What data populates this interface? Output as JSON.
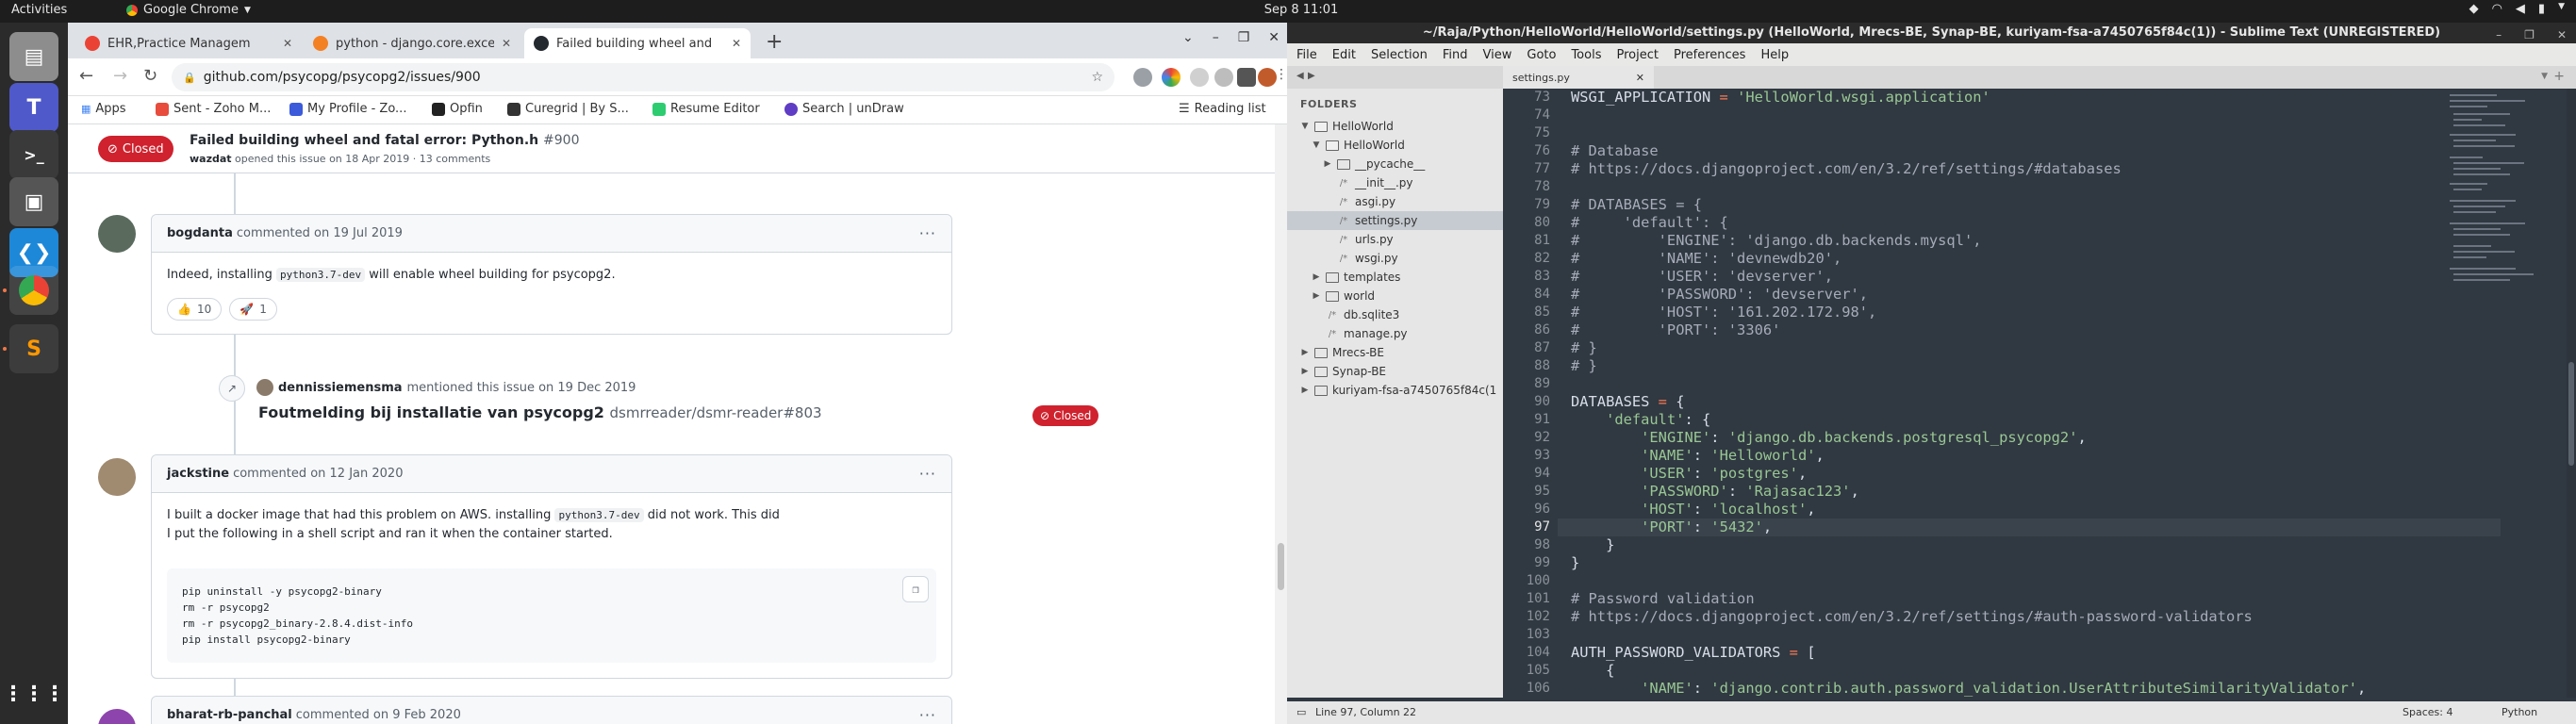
{
  "topbar": {
    "activities": "Activities",
    "app_name": "Google Chrome",
    "clock": "Sep 8  11:01"
  },
  "dock": {
    "apps": [
      "files",
      "teams",
      "terminal",
      "image-viewer",
      "vscode",
      "chrome",
      "sublime-text",
      "app-grid"
    ]
  },
  "chrome": {
    "tabs": [
      {
        "label": "EHR,Practice Managem",
        "favicon_color": "#ea4335"
      },
      {
        "label": "python - django.core.exce",
        "favicon_color": "#f48024"
      },
      {
        "label": "Failed building wheel and",
        "favicon_color": "#24292f"
      }
    ],
    "url": "github.com/psycopg/psycopg2/issues/900",
    "bookmarks": [
      {
        "label": "Apps",
        "color": "#4285f4"
      },
      {
        "label": "Sent - Zoho M...",
        "color": "#e74c3c"
      },
      {
        "label": "My Profile - Zo...",
        "color": "#3b5bdb"
      },
      {
        "label": "Opfin",
        "color": "#222222"
      },
      {
        "label": "Curegrid | By S...",
        "color": "#333333"
      },
      {
        "label": "Resume Editor",
        "color": "#2ecc71"
      },
      {
        "label": "Search | unDraw",
        "color": "#5f3dc4"
      }
    ],
    "reading_list": "Reading list"
  },
  "issue": {
    "state": "Closed",
    "title": "Failed building wheel and fatal error: Python.h",
    "number": "#900",
    "author": "wazdat",
    "meta": "opened this issue on 18 Apr 2019 · 13 comments",
    "comments": [
      {
        "author": "bogdanta",
        "date": "commented on 19 Jul 2019",
        "text_before": "Indeed, installing",
        "code": "python3.7-dev",
        "text_after": "will enable wheel building for psycopg2.",
        "reactions": [
          {
            "emoji": "👍",
            "count": "10"
          },
          {
            "emoji": "🚀",
            "count": "1"
          }
        ]
      },
      {
        "author": "jackstine",
        "date": "commented on 12 Jan 2020",
        "line1_before": "I built a docker image that had this problem on AWS. installing",
        "line1_code": "python3.7-dev",
        "line1_after": "did not work. This did",
        "line2": "I put the following in a shell script and ran it when the container started.",
        "codeblock": [
          "pip uninstall -y psycopg2-binary",
          "rm -r psycopg2",
          "rm -r psycopg2_binary-2.8.4.dist-info",
          "pip install psycopg2-binary"
        ]
      },
      {
        "author": "bharat-rb-panchal",
        "date": "commented on 9 Feb 2020"
      }
    ],
    "mention": {
      "author": "dennissiemensma",
      "text": "mentioned this issue on 19 Dec 2019",
      "title": "Foutmelding bij installatie van psycopg2",
      "ref": "dsmrreader/dsmr-reader#803",
      "state": "Closed"
    }
  },
  "sublime": {
    "title": "~/Raja/Python/HelloWorld/HelloWorld/settings.py (HelloWorld, Mrecs-BE, Synap-BE, kuriyam-fsa-a7450765f84c(1)) - Sublime Text (UNREGISTERED)",
    "menu": [
      "File",
      "Edit",
      "Selection",
      "Find",
      "View",
      "Goto",
      "Tools",
      "Project",
      "Preferences",
      "Help"
    ],
    "sidebar_title": "FOLDERS",
    "tree": [
      {
        "label": "HelloWorld",
        "kind": "folder-open",
        "depth": 0
      },
      {
        "label": "HelloWorld",
        "kind": "folder-open",
        "depth": 1
      },
      {
        "label": "__pycache__",
        "kind": "folder",
        "depth": 2
      },
      {
        "label": "__init__.py",
        "kind": "file",
        "depth": 2
      },
      {
        "label": "asgi.py",
        "kind": "file",
        "depth": 2
      },
      {
        "label": "settings.py",
        "kind": "file",
        "depth": 2,
        "selected": true
      },
      {
        "label": "urls.py",
        "kind": "file",
        "depth": 2
      },
      {
        "label": "wsgi.py",
        "kind": "file",
        "depth": 2
      },
      {
        "label": "templates",
        "kind": "folder",
        "depth": 1
      },
      {
        "label": "world",
        "kind": "folder",
        "depth": 1
      },
      {
        "label": "db.sqlite3",
        "kind": "file",
        "depth": 1
      },
      {
        "label": "manage.py",
        "kind": "file",
        "depth": 1
      },
      {
        "label": "Mrecs-BE",
        "kind": "folder",
        "depth": 0
      },
      {
        "label": "Synap-BE",
        "kind": "folder",
        "depth": 0
      },
      {
        "label": "kuriyam-fsa-a7450765f84c(1",
        "kind": "folder",
        "depth": 0
      }
    ],
    "tab": "settings.py",
    "lines": [
      {
        "n": "73",
        "t": "WSGI_APPLICATION = 'HelloWorld.wsgi.application'"
      },
      {
        "n": "74",
        "t": ""
      },
      {
        "n": "75",
        "t": ""
      },
      {
        "n": "76",
        "t": "# Database"
      },
      {
        "n": "77",
        "t": "# https://docs.djangoproject.com/en/3.2/ref/settings/#databases"
      },
      {
        "n": "78",
        "t": ""
      },
      {
        "n": "79",
        "t": "# DATABASES = {"
      },
      {
        "n": "80",
        "t": "#     'default': {"
      },
      {
        "n": "81",
        "t": "#         'ENGINE': 'django.db.backends.mysql',"
      },
      {
        "n": "82",
        "t": "#         'NAME': 'devnewdb20',"
      },
      {
        "n": "83",
        "t": "#         'USER': 'devserver',"
      },
      {
        "n": "84",
        "t": "#         'PASSWORD': 'devserver',"
      },
      {
        "n": "85",
        "t": "#         'HOST': '161.202.172.98',"
      },
      {
        "n": "86",
        "t": "#         'PORT': '3306'"
      },
      {
        "n": "87",
        "t": "# }"
      },
      {
        "n": "88",
        "t": "# }"
      },
      {
        "n": "89",
        "t": ""
      },
      {
        "n": "90",
        "t": "DATABASES = {"
      },
      {
        "n": "91",
        "t": "    'default': {"
      },
      {
        "n": "92",
        "t": "        'ENGINE': 'django.db.backends.postgresql_psycopg2',"
      },
      {
        "n": "93",
        "t": "        'NAME': 'Helloworld',"
      },
      {
        "n": "94",
        "t": "        'USER': 'postgres',"
      },
      {
        "n": "95",
        "t": "        'PASSWORD': 'Rajasac123',"
      },
      {
        "n": "96",
        "t": "        'HOST': 'localhost',"
      },
      {
        "n": "97",
        "t": "        'PORT': '5432',"
      },
      {
        "n": "98",
        "t": "    }"
      },
      {
        "n": "99",
        "t": "}"
      },
      {
        "n": "100",
        "t": ""
      },
      {
        "n": "101",
        "t": "# Password validation"
      },
      {
        "n": "102",
        "t": "# https://docs.djangoproject.com/en/3.2/ref/settings/#auth-password-validators"
      },
      {
        "n": "103",
        "t": ""
      },
      {
        "n": "104",
        "t": "AUTH_PASSWORD_VALIDATORS = ["
      },
      {
        "n": "105",
        "t": "    {"
      },
      {
        "n": "106",
        "t": "        'NAME': 'django.contrib.auth.password_validation.UserAttributeSimilarityValidator',"
      }
    ],
    "current_line": "97",
    "status": {
      "position": "Line 97, Column 22",
      "spaces": "Spaces: 4",
      "syntax": "Python"
    }
  }
}
